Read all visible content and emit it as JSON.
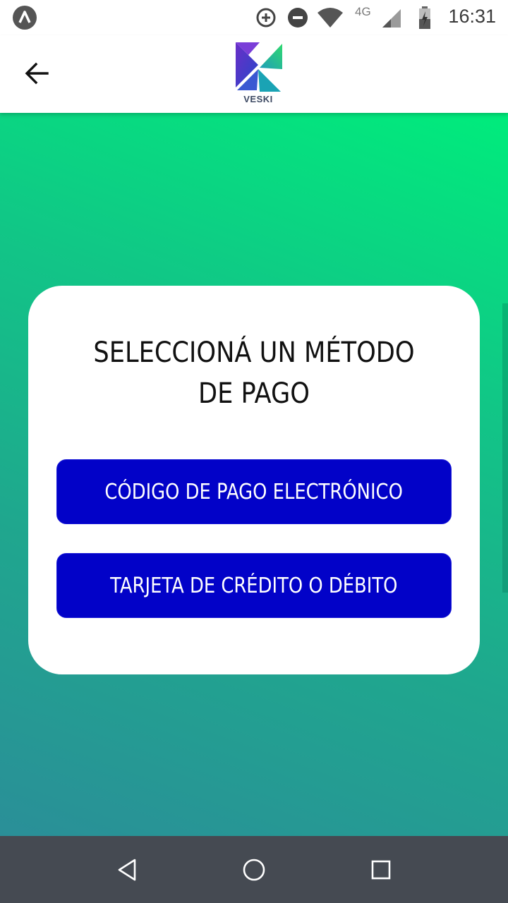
{
  "status_bar": {
    "time": "16:31",
    "network_type": "4G",
    "icons": [
      "app-notification-icon",
      "data-saver-icon",
      "do-not-disturb-icon",
      "wifi-icon",
      "cell-signal-icon",
      "battery-charging-icon"
    ]
  },
  "app_bar": {
    "back_icon": "arrow-left-icon",
    "logo_text": "VESKI"
  },
  "card": {
    "title": "SELECCIONÁ UN MÉTODO DE PAGO",
    "buttons": [
      {
        "label": "CÓDIGO DE PAGO ELECTRÓNICO"
      },
      {
        "label": "TARJETA DE CRÉDITO O DÉBITO"
      }
    ]
  },
  "nav_bar": {
    "icons": [
      "back-triangle-icon",
      "home-circle-icon",
      "recents-square-icon"
    ]
  },
  "colors": {
    "gradient_top": "#00ec7c",
    "gradient_bottom": "#2a8f98",
    "button_blue": "#0202c8",
    "nav_bar": "#454a52"
  }
}
